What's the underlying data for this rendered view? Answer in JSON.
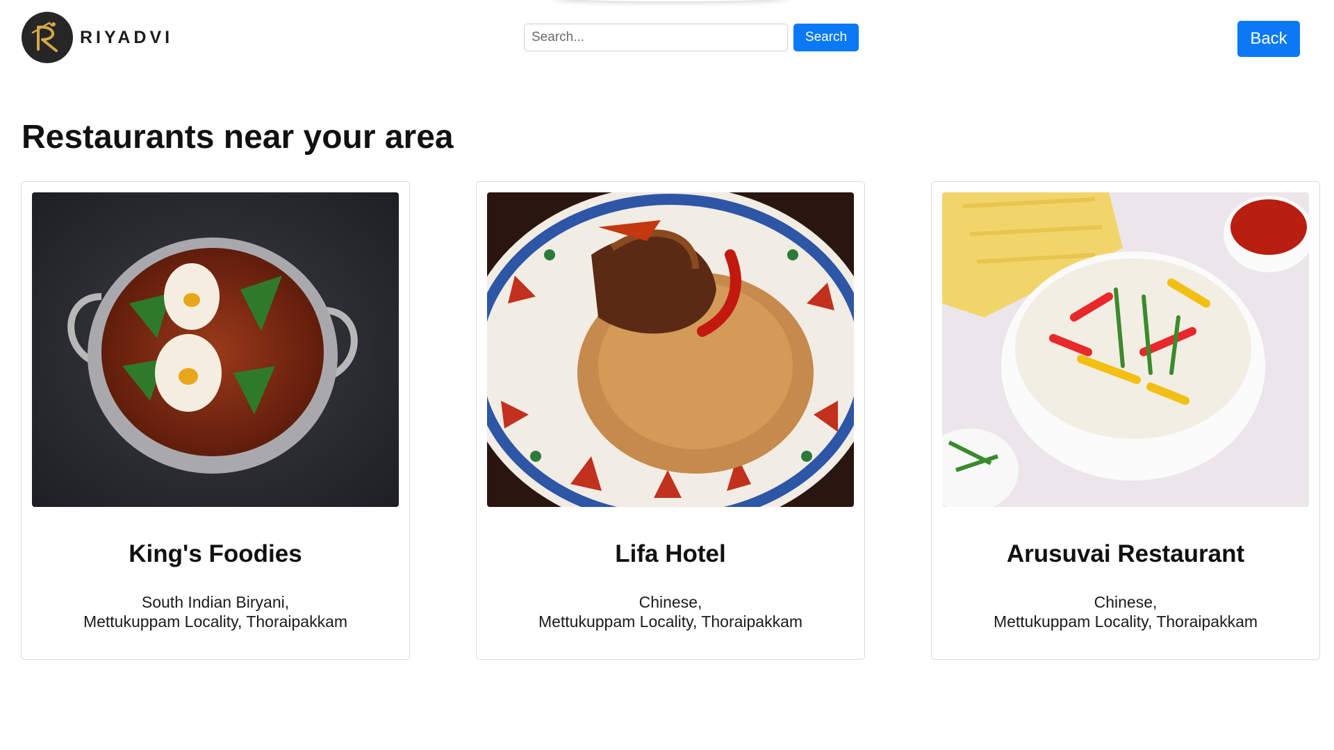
{
  "header": {
    "brand_name": "RIYADVI",
    "search_placeholder": "Search...",
    "search_button_label": "Search",
    "back_button_label": "Back"
  },
  "page_title": "Restaurants near your area",
  "restaurants": [
    {
      "name": "King's Foodies",
      "cuisine": "South Indian Biryani,",
      "address": "Mettukuppam Locality, Thoraipakkam"
    },
    {
      "name": "Lifa Hotel",
      "cuisine": "Chinese,",
      "address": "Mettukuppam Locality, Thoraipakkam"
    },
    {
      "name": "Arusuvai Restaurant",
      "cuisine": "Chinese,",
      "address": "Mettukuppam Locality, Thoraipakkam"
    }
  ],
  "colors": {
    "accent": "#0b79f5",
    "logo_bg": "#262626",
    "logo_gold": "#d4a84a"
  },
  "icons": {
    "logo": "riyadvi-logo-icon"
  }
}
